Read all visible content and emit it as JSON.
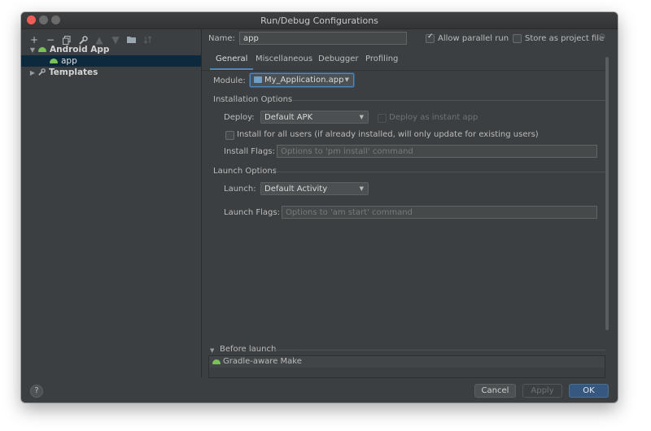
{
  "window": {
    "title": "Run/Debug Configurations"
  },
  "toolbar": {
    "icons": [
      "plus-icon",
      "minus-icon",
      "copy-icon",
      "wrench-icon",
      "arrow-up-icon",
      "arrow-down-icon",
      "folder-icon",
      "sort-icon"
    ]
  },
  "tree": {
    "android_app": "Android App",
    "app": "app",
    "templates": "Templates"
  },
  "config": {
    "name_label": "Name:",
    "name_value": "app",
    "allow_parallel_label": "Allow parallel run",
    "allow_parallel_checked": true,
    "store_project_label": "Store as project file",
    "store_project_checked": false
  },
  "tabs": [
    {
      "label": "General",
      "active": true
    },
    {
      "label": "Miscellaneous",
      "active": false
    },
    {
      "label": "Debugger",
      "active": false
    },
    {
      "label": "Profiling",
      "active": false
    }
  ],
  "general": {
    "module_label": "Module:",
    "module_value": "My_Application.app",
    "installation_title": "Installation Options",
    "deploy_label": "Deploy:",
    "deploy_value": "Default APK",
    "instant_app_label": "Deploy as instant app",
    "install_all_label": "Install for all users (if already installed, will only update for existing users)",
    "install_flags_label": "Install Flags:",
    "install_flags_placeholder": "Options to 'pm install' command",
    "launch_title": "Launch Options",
    "launch_label": "Launch:",
    "launch_value": "Default Activity",
    "launch_flags_label": "Launch Flags:",
    "launch_flags_placeholder": "Options to 'am start' command"
  },
  "before_launch": {
    "title": "Before launch",
    "items": [
      "Gradle-aware Make"
    ]
  },
  "buttons": {
    "help": "?",
    "cancel": "Cancel",
    "apply": "Apply",
    "ok": "OK"
  },
  "colors": {
    "background": "#3c3f41",
    "accent": "#4a88c7",
    "ok_button": "#365880",
    "android_green": "#78c257",
    "close_dot": "#ee5e57"
  }
}
